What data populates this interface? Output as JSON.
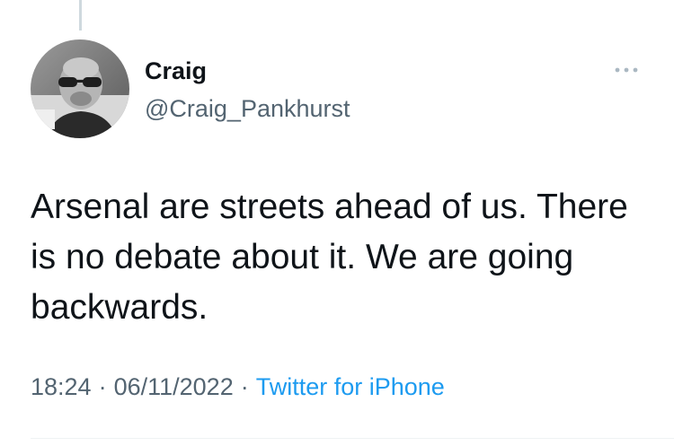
{
  "tweet": {
    "author_name": "Craig",
    "author_handle": "@Craig_Pankhurst",
    "text": "Arsenal are streets ahead of us. There is no debate about it. We are going backwards.",
    "time": "18:24",
    "separator": "·",
    "date": "06/11/2022",
    "source": "Twitter for iPhone",
    "more_icon": "more-horizontal-icon"
  },
  "colors": {
    "text_primary": "#0f1419",
    "text_secondary": "#536471",
    "link": "#1d9bf0",
    "thread_line": "#cfd9de"
  }
}
